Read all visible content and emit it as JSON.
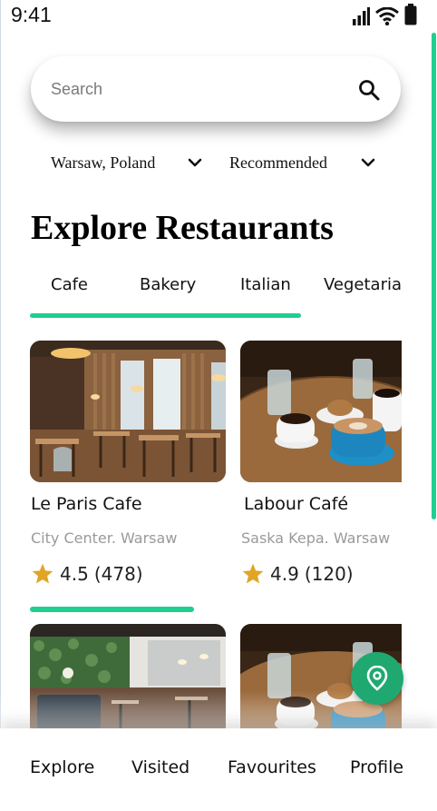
{
  "status_bar": {
    "time": "9:41",
    "icons": [
      "signal-icon",
      "wifi-icon",
      "battery-icon"
    ]
  },
  "search": {
    "placeholder": "Search",
    "value": "",
    "icon": "search-icon"
  },
  "filters": {
    "location": "Warsaw, Poland",
    "sort": "Recommended"
  },
  "title": "Explore Restaurants",
  "categories": [
    "Cafe",
    "Bakery",
    "Italian",
    "Vegetarian"
  ],
  "selected_category": "Cafe",
  "restaurants": [
    {
      "name": "Le Paris Cafe",
      "location": "City Center. Warsaw",
      "rating": "4.5",
      "reviews": "(478)",
      "image": "restaurant-interior-photo"
    },
    {
      "name": "Labour Café",
      "location": "Saska Kepa. Warsaw",
      "rating": "4.9",
      "reviews": "(120)",
      "image": "coffee-table-photo"
    },
    {
      "name": "",
      "location": "",
      "rating": "",
      "reviews": "",
      "image": "green-wall-cafe-photo"
    },
    {
      "name": "",
      "location": "",
      "rating": "",
      "reviews": "",
      "image": "coffee-table-photo"
    }
  ],
  "bottom_nav": [
    "Explore",
    "Visited",
    "Favourites",
    "Profile"
  ],
  "colors": {
    "accent": "#1fcf8f",
    "fab": "#1fa971",
    "star": "#e0a526",
    "muted_text": "#9a9a9a"
  }
}
